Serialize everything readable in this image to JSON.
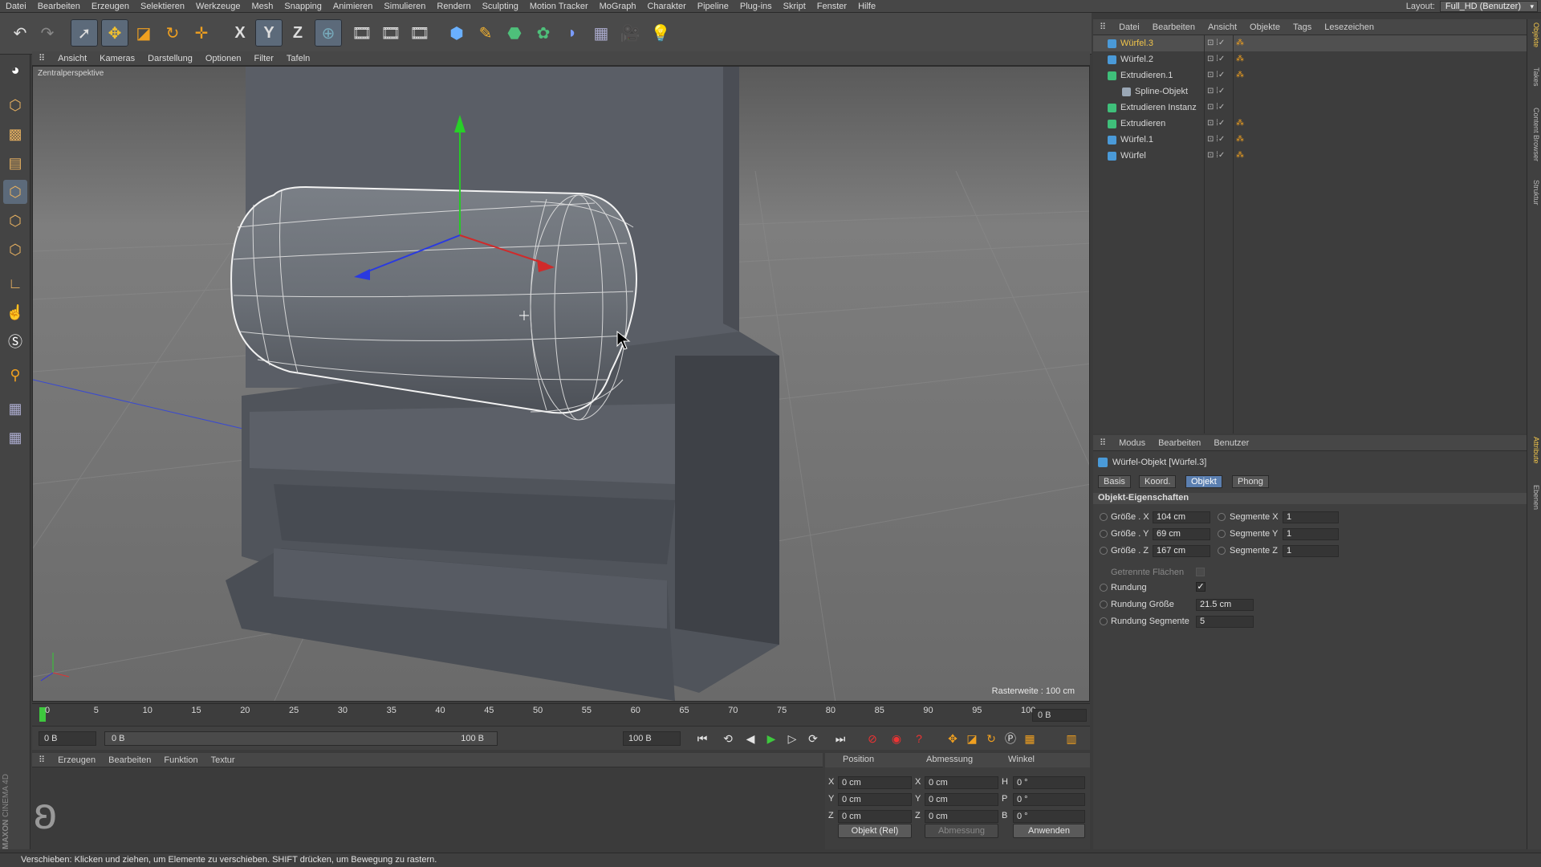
{
  "menubar": {
    "items": [
      "Datei",
      "Bearbeiten",
      "Erzeugen",
      "Selektieren",
      "Werkzeuge",
      "Mesh",
      "Snapping",
      "Animieren",
      "Simulieren",
      "Rendern",
      "Sculpting",
      "Motion Tracker",
      "MoGraph",
      "Charakter",
      "Pipeline",
      "Plug-ins",
      "Skript",
      "Fenster",
      "Hilfe"
    ],
    "layout_label": "Layout:",
    "layout_value": "Full_HD (Benutzer)"
  },
  "toolbar": {
    "axis_x": "X",
    "axis_y": "Y",
    "axis_z": "Z"
  },
  "viewport": {
    "menu": [
      "Ansicht",
      "Kameras",
      "Darstellung",
      "Optionen",
      "Filter",
      "Tafeln"
    ],
    "camera_label": "Zentralperspektive",
    "grid_label": "Rasterweite : 100 cm"
  },
  "timeline": {
    "ticks": [
      "0",
      "5",
      "10",
      "15",
      "20",
      "25",
      "30",
      "35",
      "40",
      "45",
      "50",
      "55",
      "60",
      "65",
      "70",
      "75",
      "80",
      "85",
      "90",
      "95",
      "100"
    ],
    "end_field": "0 B",
    "start_field": "0 B",
    "range_start": "0 B",
    "range_end": "100 B",
    "max_field": "100 B"
  },
  "material": {
    "menu": [
      "Erzeugen",
      "Bearbeiten",
      "Funktion",
      "Textur"
    ]
  },
  "coordinates": {
    "header_position": "Position",
    "header_size": "Abmessung",
    "header_angle": "Winkel",
    "rows": [
      {
        "axis": "X",
        "pos": "0 cm",
        "saxis": "X",
        "size": "0 cm",
        "aaxis": "H",
        "angle": "0 °"
      },
      {
        "axis": "Y",
        "pos": "0 cm",
        "saxis": "Y",
        "size": "0 cm",
        "aaxis": "P",
        "angle": "0 °"
      },
      {
        "axis": "Z",
        "pos": "0 cm",
        "saxis": "Z",
        "size": "0 cm",
        "aaxis": "B",
        "angle": "0 °"
      }
    ],
    "mode": "Objekt (Rel)",
    "size_mode": "Abmessung",
    "apply": "Anwenden"
  },
  "status": "Verschieben: Klicken und ziehen, um Elemente zu verschieben. SHIFT drücken, um Bewegung zu rastern.",
  "logo": {
    "brand": "MAXON",
    "product": "CINEMA 4D"
  },
  "object_manager": {
    "menu": [
      "Datei",
      "Bearbeiten",
      "Ansicht",
      "Objekte",
      "Tags",
      "Lesezeichen"
    ],
    "objects": [
      {
        "name": "Würfel.3",
        "color": "#f0c44a",
        "icon": "cube-icon",
        "selected": true
      },
      {
        "name": "Würfel.2",
        "color": "#d6d6d6",
        "icon": "cube-icon"
      },
      {
        "name": "Extrudieren.1",
        "color": "#d6d6d6",
        "icon": "extrude-icon"
      },
      {
        "name": "Spline-Objekt",
        "color": "#d6d6d6",
        "icon": "spline-icon"
      },
      {
        "name": "Extrudieren Instanz",
        "color": "#d6d6d6",
        "icon": "instance-icon"
      },
      {
        "name": "Extrudieren",
        "color": "#d6d6d6",
        "icon": "extrude-icon"
      },
      {
        "name": "Würfel.1",
        "color": "#d6d6d6",
        "icon": "cube-icon"
      },
      {
        "name": "Würfel",
        "color": "#d6d6d6",
        "icon": "cube-icon"
      }
    ]
  },
  "attribute_manager": {
    "menu": [
      "Modus",
      "Bearbeiten",
      "Benutzer"
    ],
    "object_title": "Würfel-Objekt [Würfel.3]",
    "tabs": [
      "Basis",
      "Koord.",
      "Objekt",
      "Phong"
    ],
    "active_tab": "Objekt",
    "section": "Objekt-Eigenschaften",
    "size_x_label": "Größe . X",
    "size_x": "104 cm",
    "size_y_label": "Größe . Y",
    "size_y": "69 cm",
    "size_z_label": "Größe . Z",
    "size_z": "167 cm",
    "seg_x_label": "Segmente X",
    "seg_x": "1",
    "seg_y_label": "Segmente Y",
    "seg_y": "1",
    "seg_z_label": "Segmente Z",
    "seg_z": "1",
    "separate_label": "Getrennte Flächen",
    "fillet_label": "Rundung",
    "fillet_checked": "✓",
    "fillet_size_label": "Rundung Größe",
    "fillet_size": "21.5 cm",
    "fillet_seg_label": "Rundung Segmente",
    "fillet_seg": "5"
  },
  "side_tabs": [
    "Objekte",
    "Takes",
    "Content Browser",
    "Struktur",
    "Attribute",
    "Ebenen"
  ]
}
